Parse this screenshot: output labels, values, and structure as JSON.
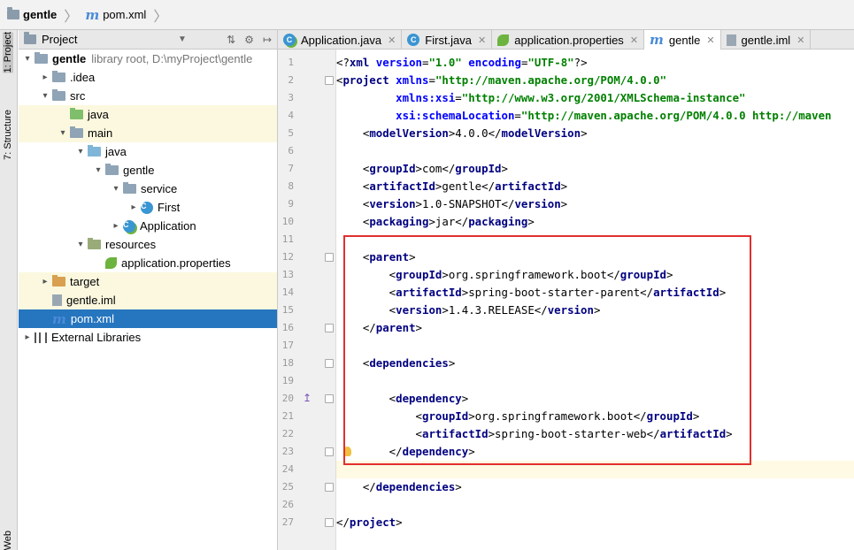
{
  "breadcrumb": {
    "project": "gentle",
    "file": "pom.xml"
  },
  "left_strip": {
    "project_label": "1: Project",
    "structure_label": "7: Structure",
    "web_label": "Web"
  },
  "project_panel": {
    "title": "Project",
    "tools": [
      "⇅",
      "⚙",
      "↦"
    ]
  },
  "tree": [
    {
      "label": "gentle",
      "extra": "library root,  D:\\myProject\\gentle",
      "depth": 0,
      "arrow": "▾",
      "icon": "module-folder-icon",
      "bold": true
    },
    {
      "label": ".idea",
      "depth": 1,
      "arrow": "▸",
      "icon": "folder-icon"
    },
    {
      "label": "src",
      "depth": 1,
      "arrow": "▾",
      "icon": "folder-icon"
    },
    {
      "label": "java",
      "depth": 2,
      "arrow": "",
      "icon": "green-folder-icon",
      "highlight": true
    },
    {
      "label": "main",
      "depth": 2,
      "arrow": "▾",
      "icon": "folder-icon",
      "highlight": true
    },
    {
      "label": "java",
      "depth": 3,
      "arrow": "▾",
      "icon": "source-folder-icon"
    },
    {
      "label": "gentle",
      "depth": 4,
      "arrow": "▾",
      "icon": "package-icon"
    },
    {
      "label": "service",
      "depth": 5,
      "arrow": "▾",
      "icon": "package-icon"
    },
    {
      "label": "First",
      "depth": 6,
      "arrow": "▸",
      "icon": "class-icon"
    },
    {
      "label": "Application",
      "depth": 5,
      "arrow": "▸",
      "icon": "spring-class-icon"
    },
    {
      "label": "resources",
      "depth": 3,
      "arrow": "▾",
      "icon": "resources-folder-icon"
    },
    {
      "label": "application.properties",
      "depth": 4,
      "arrow": "",
      "icon": "spring-leaf-icon"
    },
    {
      "label": "target",
      "depth": 1,
      "arrow": "▸",
      "icon": "orange-folder-icon",
      "highlight": true
    },
    {
      "label": "gentle.iml",
      "depth": 1,
      "arrow": "",
      "icon": "iml-icon",
      "highlight": true
    },
    {
      "label": "pom.xml",
      "depth": 1,
      "arrow": "",
      "icon": "maven-icon",
      "selected": true
    },
    {
      "label": "External Libraries",
      "depth": 0,
      "arrow": "▸",
      "icon": "library-icon"
    }
  ],
  "tabs": [
    {
      "label": "Application.java",
      "icon": "spring-class-icon",
      "active": false
    },
    {
      "label": "First.java",
      "icon": "class-icon",
      "active": false
    },
    {
      "label": "application.properties",
      "icon": "spring-leaf-icon",
      "active": false
    },
    {
      "label": "gentle",
      "icon": "maven-icon",
      "active": true
    },
    {
      "label": "gentle.iml",
      "icon": "iml-icon",
      "active": false
    }
  ],
  "editor": {
    "lines": [
      {
        "n": "1",
        "html": "<span class='txt'>&lt;?</span><span class='tag'>xml</span> <span class='attr'>version</span>=<span class='val'>\"1.0\"</span> <span class='attr'>encoding</span>=<span class='val'>\"UTF-8\"</span><span class='txt'>?&gt;</span>"
      },
      {
        "n": "2",
        "html": "&lt;<span class='tag'>project</span> <span class='attr'>xmlns</span>=<span class='val'>\"http://maven.apache.org/POM/4.0.0\"</span>"
      },
      {
        "n": "3",
        "html": "         <span class='attr'>xmlns:xsi</span>=<span class='val'>\"http://www.w3.org/2001/XMLSchema-instance\"</span>"
      },
      {
        "n": "4",
        "html": "         <span class='attr'>xsi:schemaLocation</span>=<span class='val'>\"http://maven.apache.org/POM/4.0.0 http://maven</span>"
      },
      {
        "n": "5",
        "html": "    &lt;<span class='tag'>modelVersion</span>&gt;4.0.0&lt;/<span class='tag'>modelVersion</span>&gt;"
      },
      {
        "n": "6",
        "html": ""
      },
      {
        "n": "7",
        "html": "    &lt;<span class='tag'>groupId</span>&gt;com&lt;/<span class='tag'>groupId</span>&gt;"
      },
      {
        "n": "8",
        "html": "    &lt;<span class='tag'>artifactId</span>&gt;gentle&lt;/<span class='tag'>artifactId</span>&gt;"
      },
      {
        "n": "9",
        "html": "    &lt;<span class='tag'>version</span>&gt;1.0-SNAPSHOT&lt;/<span class='tag'>version</span>&gt;"
      },
      {
        "n": "10",
        "html": "    &lt;<span class='tag'>packaging</span>&gt;jar&lt;/<span class='tag'>packaging</span>&gt;"
      },
      {
        "n": "11",
        "html": ""
      },
      {
        "n": "12",
        "html": "    &lt;<span class='tag'>parent</span>&gt;"
      },
      {
        "n": "13",
        "html": "        &lt;<span class='tag'>groupId</span>&gt;org.springframework.boot&lt;/<span class='tag'>groupId</span>&gt;"
      },
      {
        "n": "14",
        "html": "        &lt;<span class='tag'>artifactId</span>&gt;spring-boot-starter-parent&lt;/<span class='tag'>artifactId</span>&gt;"
      },
      {
        "n": "15",
        "html": "        &lt;<span class='tag'>version</span>&gt;1.4.3.RELEASE&lt;/<span class='tag'>version</span>&gt;"
      },
      {
        "n": "16",
        "html": "    &lt;/<span class='tag'>parent</span>&gt;"
      },
      {
        "n": "17",
        "html": ""
      },
      {
        "n": "18",
        "html": "    &lt;<span class='tag'>dependencies</span>&gt;"
      },
      {
        "n": "19",
        "html": ""
      },
      {
        "n": "20",
        "html": "        &lt;<span class='tag'>dependency</span>&gt;"
      },
      {
        "n": "21",
        "html": "            &lt;<span class='tag'>groupId</span>&gt;org.springframework.boot&lt;/<span class='tag'>groupId</span>&gt;"
      },
      {
        "n": "22",
        "html": "            &lt;<span class='tag'>artifactId</span>&gt;spring-boot-starter-web&lt;/<span class='tag'>artifactId</span>&gt;"
      },
      {
        "n": "23",
        "html": "        &lt;/<span class='tag'>dependency</span>&gt;"
      },
      {
        "n": "24",
        "html": ""
      },
      {
        "n": "25",
        "html": "    &lt;/<span class='tag'>dependencies</span>&gt;"
      },
      {
        "n": "26",
        "html": ""
      },
      {
        "n": "27",
        "html": "&lt;/<span class='tag'>project</span>&gt;"
      }
    ]
  }
}
